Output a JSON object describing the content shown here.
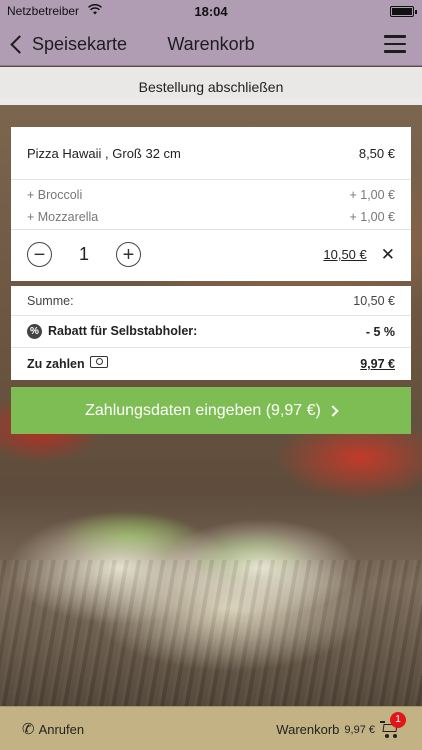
{
  "status_bar": {
    "carrier": "Netzbetreiber",
    "time": "18:04"
  },
  "nav": {
    "back_label": "Speisekarte",
    "title": "Warenkorb",
    "menu_icon": "hamburger-icon"
  },
  "subheader": {
    "title": "Bestellung abschließen"
  },
  "cart_item": {
    "name": "Pizza Hawaii , Groß 32 cm",
    "price": "8,50 €",
    "extras": [
      {
        "label": "+ Broccoli",
        "price": "+ 1,00 €"
      },
      {
        "label": "+ Mozzarella",
        "price": "+ 1,00 €"
      }
    ],
    "quantity": "1",
    "line_total": "10,50 €",
    "remove_symbol": "✕",
    "minus_symbol": "−",
    "plus_symbol": "+"
  },
  "totals": {
    "sum_label": "Summe:",
    "sum_value": "10,50 €",
    "discount_label": "Rabatt für Selbstabholer:",
    "discount_value": "- 5 %",
    "pay_label": "Zu zahlen",
    "pay_value": "9,97 €"
  },
  "pay_button": {
    "label": "Zahlungsdaten eingeben (9,97 €)"
  },
  "bottom_bar": {
    "call_label": "Anrufen",
    "cart_label": "Warenkorb",
    "cart_amount": "9,97 €",
    "cart_count": "1"
  },
  "colors": {
    "nav_background": "#b09cb3",
    "pay_button": "#7ebd53",
    "bottom_bar": "#c3b384",
    "badge": "#e0161b"
  }
}
